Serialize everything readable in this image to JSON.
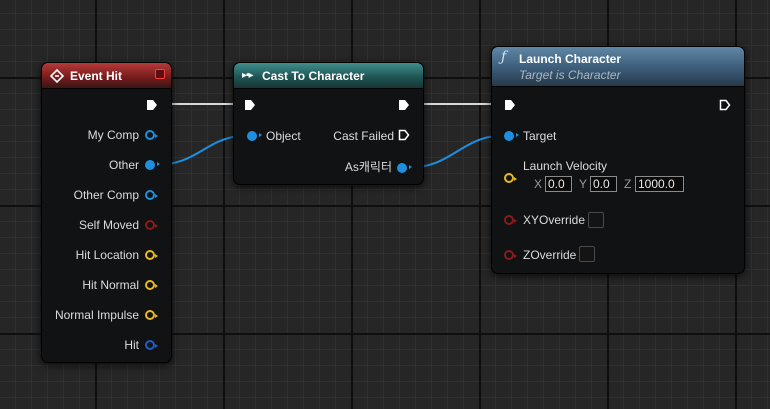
{
  "colors": {
    "object_pin": "#1e8fe0",
    "struct_pin": "#1a5fc8",
    "bool_pin": "#8b1a1a",
    "vector_pin": "#e8b81e",
    "exec": "#ffffff"
  },
  "event_node": {
    "title": "Event Hit",
    "icon": "event-diamond-icon",
    "pins": [
      "My Comp",
      "Other",
      "Other Comp",
      "Self Moved",
      "Hit Location",
      "Hit Normal",
      "Normal Impulse",
      "Hit"
    ]
  },
  "cast_node": {
    "title": "Cast To Character",
    "icon": "cast-arrows-icon",
    "object_label": "Object",
    "cast_failed_label": "Cast Failed",
    "as_label": "As캐릭터"
  },
  "launch_node": {
    "title": "Launch Character",
    "subtitle": "Target is Character",
    "icon": "function-icon",
    "target_label": "Target",
    "velocity_label": "Launch Velocity",
    "velocity": {
      "x_label": "X",
      "x": "0.0",
      "y_label": "Y",
      "y": "0.0",
      "z_label": "Z",
      "z": "1000.0"
    },
    "xy_override_label": "XYOverride",
    "z_override_label": "ZOverride"
  }
}
